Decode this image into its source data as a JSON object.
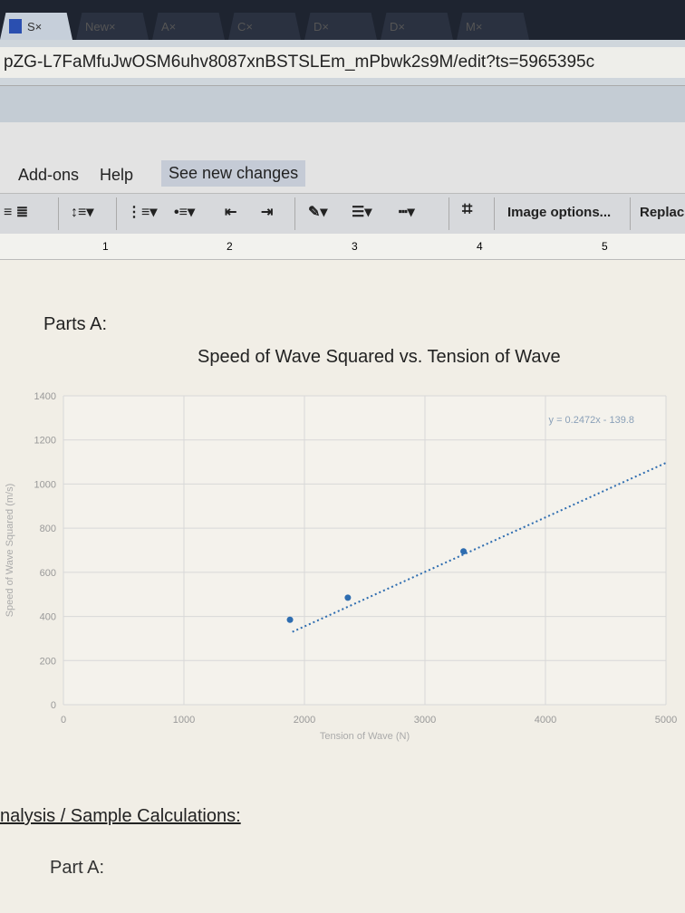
{
  "browser": {
    "tabs": [
      {
        "label": "S",
        "active": true
      },
      {
        "label": "New"
      },
      {
        "label": "A"
      },
      {
        "label": "C"
      },
      {
        "label": "D"
      },
      {
        "label": "D"
      },
      {
        "label": "M"
      }
    ],
    "url": "pZG-L7FaMfuJwOSM6uhv8087xnBSTSLEm_mPbwk2s9M/edit?ts=5965395c"
  },
  "menu": {
    "addons": "Add-ons",
    "help": "Help",
    "see_changes": "See new changes"
  },
  "toolbar": {
    "image_options": "Image options...",
    "replace": "Replac"
  },
  "ruler": [
    "1",
    "2",
    "3",
    "4",
    "5"
  ],
  "doc": {
    "heading": "Parts A:",
    "analysis": "nalysis / Sample Calculations:",
    "part_a": "Part A:"
  },
  "chart_data": {
    "type": "scatter",
    "title": "Speed of Wave Squared vs. Tension of Wave",
    "xlabel": "Tension of Wave (N)",
    "ylabel": "Speed of Wave Squared (m/s)",
    "xlim": [
      0,
      5000
    ],
    "ylim": [
      0,
      1400
    ],
    "xticks": [
      "0",
      "1000",
      "2000",
      "3000",
      "4000",
      "5000"
    ],
    "yticks": [
      "0",
      "200",
      "400",
      "600",
      "800",
      "1000",
      "1200",
      "1400"
    ],
    "points": [
      {
        "x": 1880,
        "y": 385
      },
      {
        "x": 2360,
        "y": 485
      },
      {
        "x": 3320,
        "y": 695
      }
    ],
    "trendline": {
      "slope": 0.2472,
      "intercept": -139.8,
      "label": "y = 0.2472x - 139.8",
      "style": "dotted"
    },
    "color": "#2e6db0",
    "grid": true
  }
}
